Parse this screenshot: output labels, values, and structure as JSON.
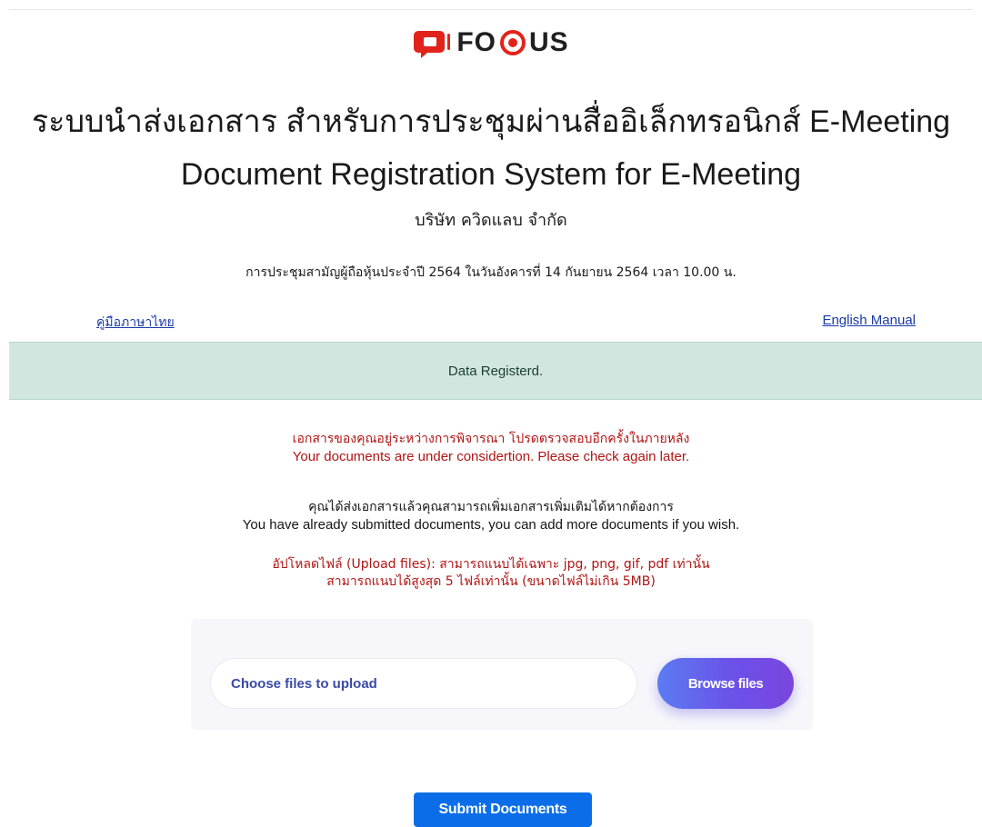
{
  "header": {
    "logo_text_left": "FO",
    "logo_text_right": "US",
    "brand_color": "#e2231a"
  },
  "title": {
    "line1": "ระบบนำส่งเอกสาร สำหรับการประชุมผ่านสื่ออิเล็กทรอนิกส์ E-Meeting",
    "line2": "Document Registration System for E-Meeting"
  },
  "company": "บริษัท ควิดแลบ จำกัด",
  "meeting": "การประชุมสามัญผู้ถือหุ้นประจำปี 2564 ในวันอังคารที่ 14 กันยายน 2564 เวลา 10.00 น.",
  "manuals": {
    "thai": "คู่มือภาษาไทย",
    "english": "English Manual"
  },
  "alert": {
    "text": "Data Registerd.",
    "color": "#d1e6de"
  },
  "notices": {
    "review_th": "เอกสารของคุณอยู่ระหว่างการพิจารณา โปรดตรวจสอบอีกครั้งในภายหลัง",
    "review_en": "Your documents are under considertion. Please check again later.",
    "submitted_th": "คุณได้ส่งเอกสารแล้วคุณสามารถเพิ่มเอกสารเพิ่มเติมได้หากต้องการ",
    "submitted_en": "You have already submitted documents, you can add more documents if you wish.",
    "upload_rule_1": "อัปโหลดไฟล์ (Upload files): สามารถแนบได้เฉพาะ jpg, png, gif, pdf เท่านั้น",
    "upload_rule_2": "สามารถแนบได้สูงสุด 5 ไฟล์เท่านั้น (ขนาดไฟล์ไม่เกิน 5MB)"
  },
  "upload": {
    "placeholder": "Choose files to upload",
    "browse_label": "Browse files"
  },
  "submit_label": "Submit Documents"
}
